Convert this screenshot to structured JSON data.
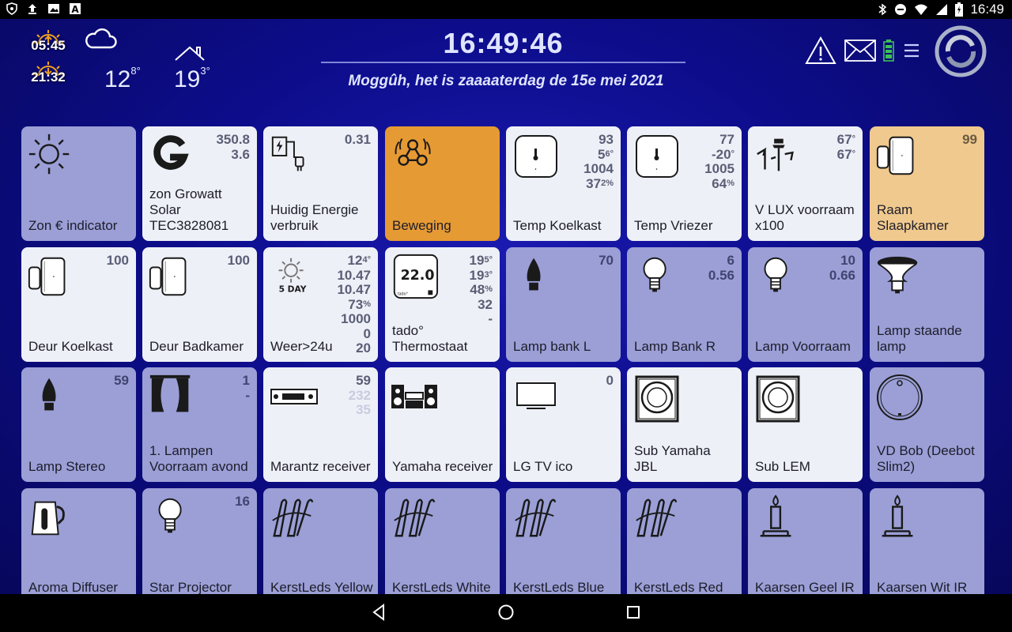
{
  "status_bar": {
    "time": "16:49"
  },
  "header": {
    "sunrise": "05:45",
    "sunset": "21:32",
    "weather_temp": "12",
    "weather_temp_dec": "8°",
    "house_temp": "19",
    "house_temp_dec": "3°",
    "clock": "16:49:46",
    "date_text": "Moggûh, het is zaaaaterdag de 15e mei 2021"
  },
  "tiles": [
    {
      "label": "Zon € indicator",
      "style": "blue",
      "icon": "sun-icon",
      "values": []
    },
    {
      "label": "zon Growatt Solar TEC3828081",
      "style": "white",
      "icon": "growatt-logo-icon",
      "values": [
        "350.8",
        "3.6"
      ]
    },
    {
      "label": "Huidig Energie verbruik",
      "style": "white",
      "icon": "energy-plug-icon",
      "values": [
        "0.31"
      ]
    },
    {
      "label": "Beweging",
      "style": "orange",
      "icon": "motion-sensor-icon",
      "values": []
    },
    {
      "label": "Temp Koelkast",
      "style": "white",
      "icon": "temperature-sensor-icon",
      "values": [
        "93",
        "5",
        "1004",
        "37"
      ],
      "sups": [
        "",
        "6°",
        "",
        "2%"
      ]
    },
    {
      "label": "Temp Vriezer",
      "style": "white",
      "icon": "temperature-sensor-icon",
      "values": [
        "77",
        "-20",
        "1005",
        "64"
      ],
      "sups": [
        "",
        "°",
        "",
        "%"
      ]
    },
    {
      "label": "V LUX voorraam x100",
      "style": "white",
      "icon": "weather-station-icon",
      "values": [
        "67",
        "67"
      ],
      "sups": [
        "°",
        "°"
      ]
    },
    {
      "label": "Raam Slaapkamer",
      "style": "peach",
      "icon": "door-sensor-icon",
      "values": [
        "99"
      ]
    },
    {
      "label": "Deur Koelkast",
      "style": "white",
      "icon": "door-sensor-icon",
      "values": [
        "100"
      ]
    },
    {
      "label": "Deur Badkamer",
      "style": "white",
      "icon": "door-sensor-icon",
      "values": [
        "100"
      ]
    },
    {
      "label": "Weer>24u",
      "style": "white",
      "icon": "five-day-weather-icon",
      "icon_text": "5 DAY",
      "values": [
        "12",
        "10.47",
        "10.47",
        "73",
        "1000",
        "0",
        "20"
      ],
      "sups": [
        "4°",
        "",
        "",
        "%",
        "",
        "",
        ""
      ]
    },
    {
      "label": "tado° Thermostaat",
      "style": "white",
      "icon": "thermostat-icon",
      "icon_text": "22.0",
      "values": [
        "19",
        "19",
        "48",
        "32",
        "-"
      ],
      "sups": [
        "5°",
        "3°",
        "%",
        "",
        ""
      ]
    },
    {
      "label": "Lamp bank L",
      "style": "blue",
      "icon": "candle-bulb-icon",
      "values": [
        "70"
      ]
    },
    {
      "label": "Lamp Bank R",
      "style": "blue",
      "icon": "bulb-icon",
      "values": [
        "6",
        "0.56"
      ]
    },
    {
      "label": "Lamp Voorraam",
      "style": "blue",
      "icon": "bulb-icon",
      "values": [
        "10",
        "0.66"
      ]
    },
    {
      "label": "Lamp staande lamp",
      "style": "blue",
      "icon": "spot-bulb-icon",
      "values": []
    },
    {
      "label": "Lamp Stereo",
      "style": "blue",
      "icon": "candle-bulb-icon",
      "values": [
        "59"
      ]
    },
    {
      "label": "1. Lampen Voorraam avond",
      "style": "blue",
      "icon": "curtains-icon",
      "values": [
        "1",
        "-"
      ]
    },
    {
      "label": "Marantz receiver",
      "style": "white",
      "icon": "receiver-icon",
      "values": [
        "59",
        "232",
        "35"
      ]
    },
    {
      "label": "Yamaha receiver",
      "style": "white",
      "icon": "stereo-system-icon",
      "values": []
    },
    {
      "label": "LG TV ico",
      "style": "white",
      "icon": "tv-icon",
      "values": [
        "0"
      ]
    },
    {
      "label": "Sub Yamaha JBL",
      "style": "white",
      "icon": "subwoofer-icon",
      "values": []
    },
    {
      "label": "Sub LEM",
      "style": "white",
      "icon": "subwoofer-icon",
      "values": []
    },
    {
      "label": "VD Bob (Deebot Slim2)",
      "style": "blue",
      "icon": "robot-vacuum-icon",
      "values": []
    },
    {
      "label": "Aroma Diffuser",
      "style": "blue",
      "icon": "kettle-icon",
      "values": []
    },
    {
      "label": "Star Projector",
      "style": "blue",
      "icon": "bulb-icon",
      "values": [
        "16"
      ]
    },
    {
      "label": "KerstLeds Yellow",
      "style": "blue",
      "icon": "led-strip-icon",
      "values": []
    },
    {
      "label": "KerstLeds White",
      "style": "blue",
      "icon": "led-strip-icon",
      "values": []
    },
    {
      "label": "KerstLeds Blue",
      "style": "blue",
      "icon": "led-strip-icon",
      "values": []
    },
    {
      "label": "KerstLeds Red",
      "style": "blue",
      "icon": "led-strip-icon",
      "values": []
    },
    {
      "label": "Kaarsen Geel IR",
      "style": "blue",
      "icon": "candle-icon",
      "values": []
    },
    {
      "label": "Kaarsen Wit IR",
      "style": "blue",
      "icon": "candle-icon",
      "values": []
    }
  ]
}
